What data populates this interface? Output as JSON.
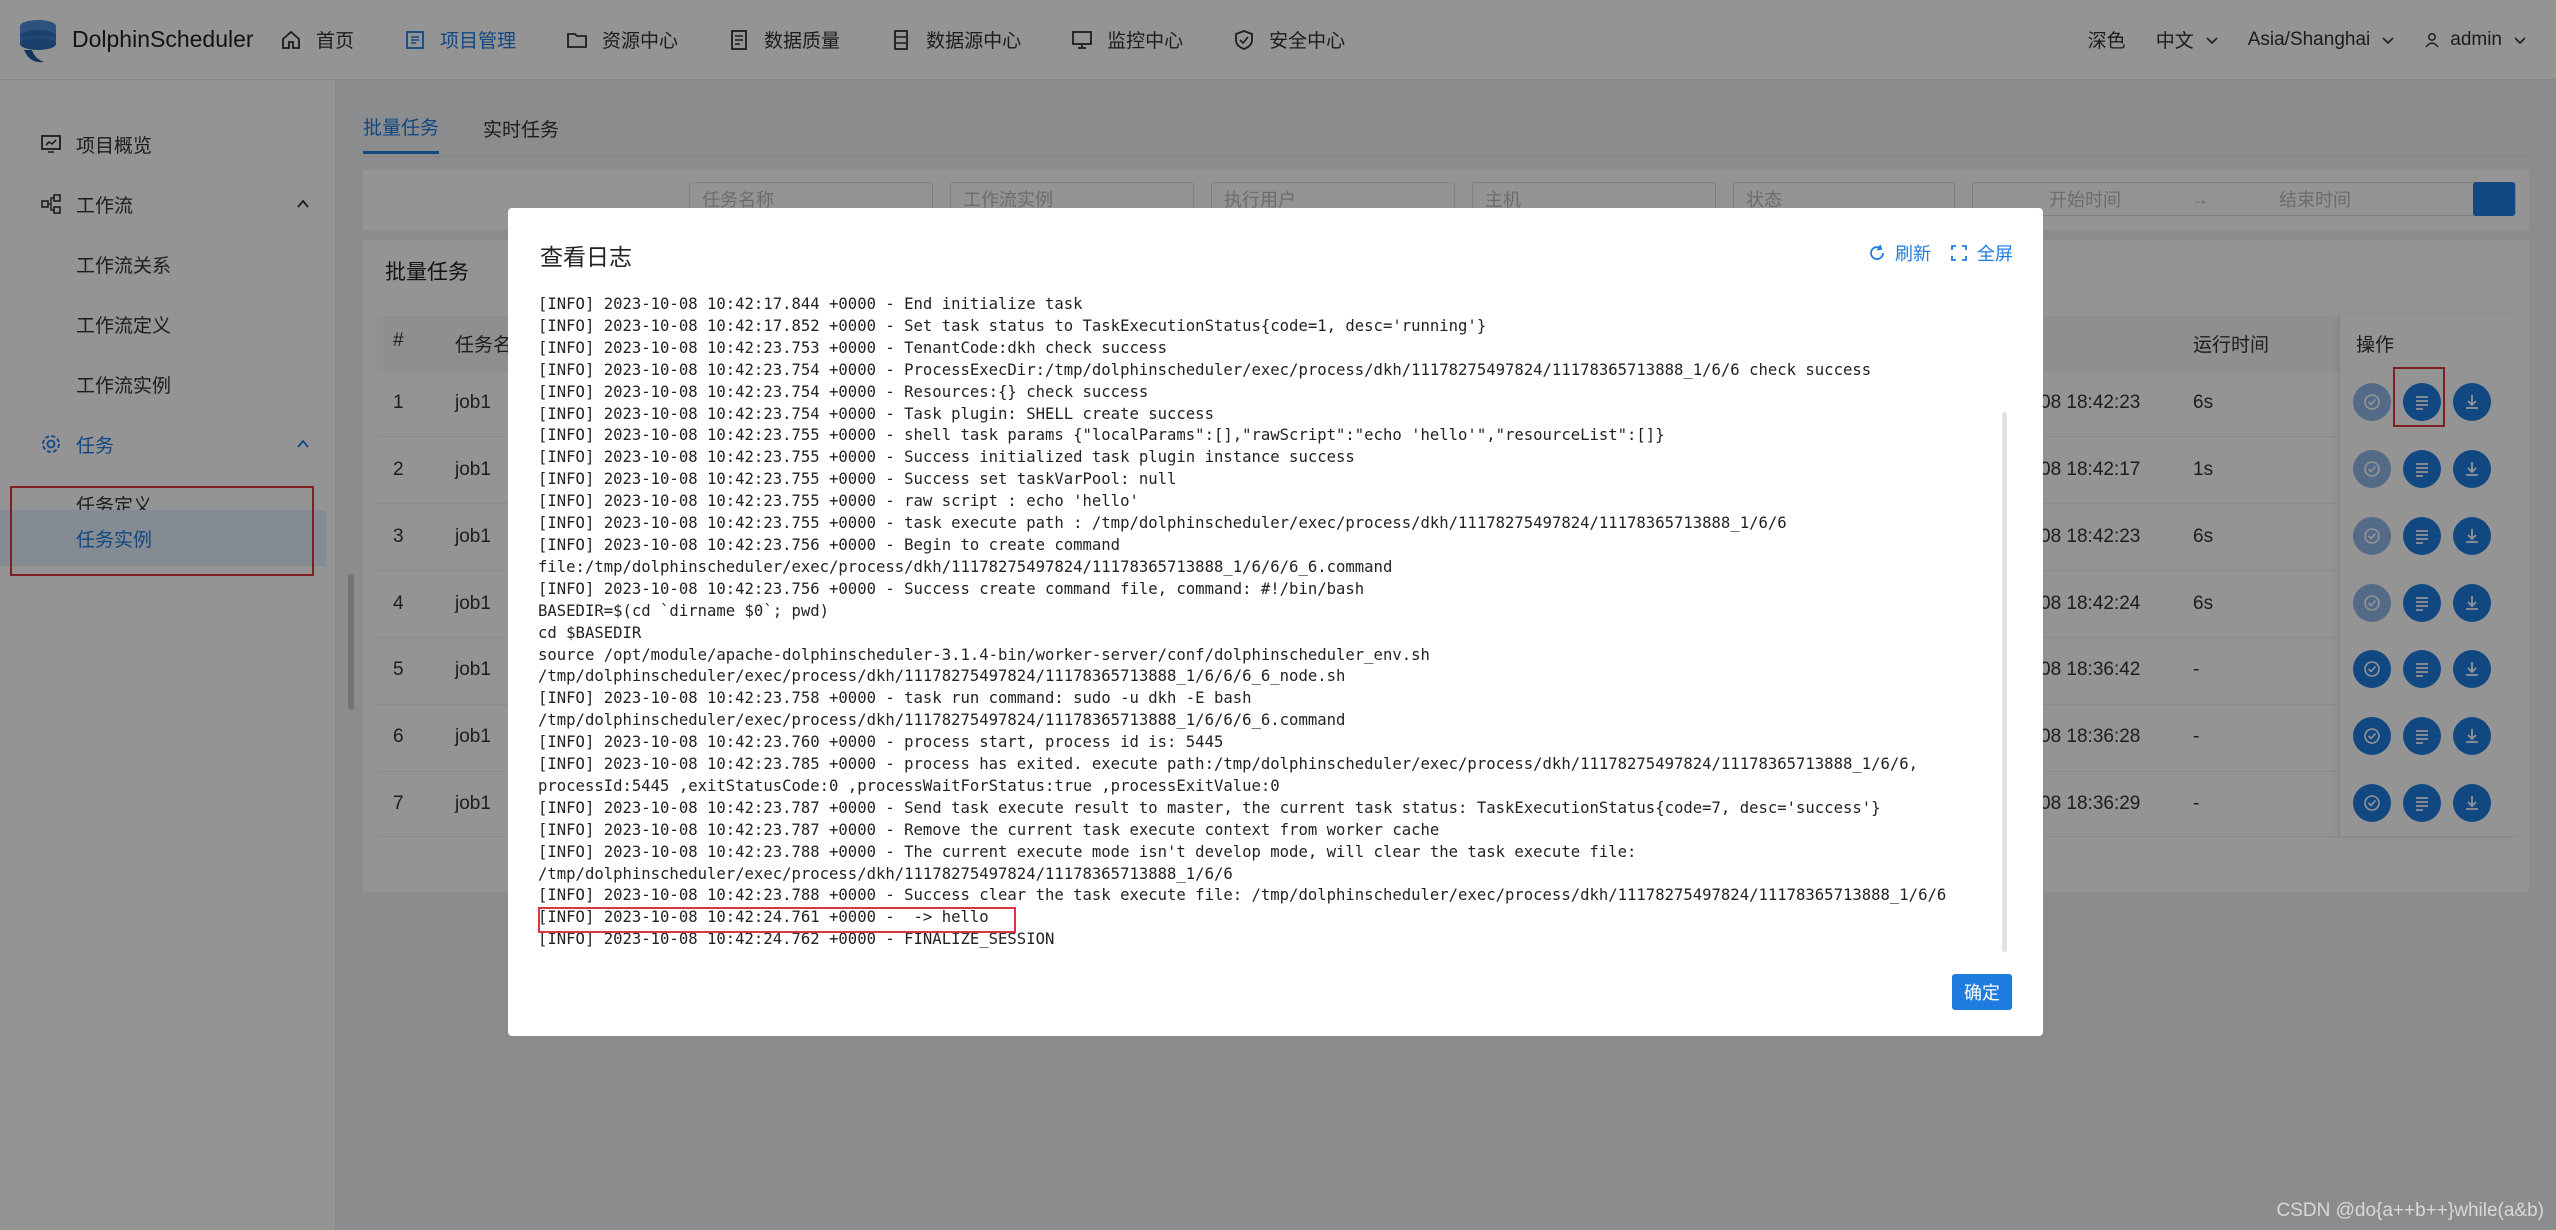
{
  "header": {
    "logo_text": "DolphinScheduler",
    "nav": [
      {
        "label": "首页",
        "icon": "home-icon"
      },
      {
        "label": "项目管理",
        "icon": "project-icon",
        "active": true
      },
      {
        "label": "资源中心",
        "icon": "folder-icon"
      },
      {
        "label": "数据质量",
        "icon": "data-quality-icon"
      },
      {
        "label": "数据源中心",
        "icon": "datasource-icon"
      },
      {
        "label": "监控中心",
        "icon": "monitor-icon"
      },
      {
        "label": "安全中心",
        "icon": "shield-icon"
      }
    ],
    "theme": "深色",
    "language": "中文",
    "timezone": "Asia/Shanghai",
    "user": "admin"
  },
  "sidebar": {
    "project_overview": "项目概览",
    "workflow": "工作流",
    "workflow_relation": "工作流关系",
    "workflow_definition": "工作流定义",
    "workflow_instance": "工作流实例",
    "task": "任务",
    "task_definition": "任务定义",
    "task_instance": "任务实例"
  },
  "tabs": {
    "batch": "批量任务",
    "realtime": "实时任务"
  },
  "filters": {
    "task_name": "任务名称",
    "workflow_instance": "工作流实例",
    "exec_user": "执行用户",
    "host": "主机",
    "state": "状态",
    "start_time": "开始时间",
    "arrow": "→",
    "end_time": "结束时间"
  },
  "list": {
    "title": "批量任务",
    "columns": {
      "index": "#",
      "task_name": "任务名",
      "run_time": "运行时间",
      "ops": "操作"
    },
    "rows": [
      {
        "index": "1",
        "name": "job1",
        "end": "08 18:42:23",
        "duration": "6s",
        "dim": true
      },
      {
        "index": "2",
        "name": "job1",
        "end": "08 18:42:17",
        "duration": "1s",
        "dim": true
      },
      {
        "index": "3",
        "name": "job1",
        "end": "08 18:42:23",
        "duration": "6s",
        "dim": true
      },
      {
        "index": "4",
        "name": "job1",
        "end": "08 18:42:24",
        "duration": "6s",
        "dim": true
      },
      {
        "index": "5",
        "name": "job1",
        "end": "08 18:36:42",
        "duration": "-",
        "dim": false
      },
      {
        "index": "6",
        "name": "job1",
        "end": "08 18:36:28",
        "duration": "-",
        "dim": false
      },
      {
        "index": "7",
        "name": "job1",
        "end": "08 18:36:29",
        "duration": "-",
        "dim": false
      }
    ]
  },
  "modal": {
    "title": "查看日志",
    "refresh": "刷新",
    "fullscreen": "全屏",
    "ok": "确定",
    "log_lines": [
      "[INFO] 2023-10-08 10:42:17.844 +0000 - End initialize task",
      "[INFO] 2023-10-08 10:42:17.852 +0000 - Set task status to TaskExecutionStatus{code=1, desc='running'}",
      "[INFO] 2023-10-08 10:42:23.753 +0000 - TenantCode:dkh check success",
      "[INFO] 2023-10-08 10:42:23.754 +0000 - ProcessExecDir:/tmp/dolphinscheduler/exec/process/dkh/11178275497824/11178365713888_1/6/6 check success",
      "[INFO] 2023-10-08 10:42:23.754 +0000 - Resources:{} check success",
      "[INFO] 2023-10-08 10:42:23.754 +0000 - Task plugin: SHELL create success",
      "[INFO] 2023-10-08 10:42:23.755 +0000 - shell task params {\"localParams\":[],\"rawScript\":\"echo 'hello'\",\"resourceList\":[]}",
      "[INFO] 2023-10-08 10:42:23.755 +0000 - Success initialized task plugin instance success",
      "[INFO] 2023-10-08 10:42:23.755 +0000 - Success set taskVarPool: null",
      "[INFO] 2023-10-08 10:42:23.755 +0000 - raw script : echo 'hello'",
      "[INFO] 2023-10-08 10:42:23.755 +0000 - task execute path : /tmp/dolphinscheduler/exec/process/dkh/11178275497824/11178365713888_1/6/6",
      "[INFO] 2023-10-08 10:42:23.756 +0000 - Begin to create command",
      "file:/tmp/dolphinscheduler/exec/process/dkh/11178275497824/11178365713888_1/6/6/6_6.command",
      "[INFO] 2023-10-08 10:42:23.756 +0000 - Success create command file, command: #!/bin/bash",
      "BASEDIR=$(cd `dirname $0`; pwd)",
      "cd $BASEDIR",
      "source /opt/module/apache-dolphinscheduler-3.1.4-bin/worker-server/conf/dolphinscheduler_env.sh",
      "/tmp/dolphinscheduler/exec/process/dkh/11178275497824/11178365713888_1/6/6/6_6_node.sh",
      "[INFO] 2023-10-08 10:42:23.758 +0000 - task run command: sudo -u dkh -E bash",
      "/tmp/dolphinscheduler/exec/process/dkh/11178275497824/11178365713888_1/6/6/6_6.command",
      "[INFO] 2023-10-08 10:42:23.760 +0000 - process start, process id is: 5445",
      "[INFO] 2023-10-08 10:42:23.785 +0000 - process has exited. execute path:/tmp/dolphinscheduler/exec/process/dkh/11178275497824/11178365713888_1/6/6,",
      "processId:5445 ,exitStatusCode:0 ,processWaitForStatus:true ,processExitValue:0",
      "[INFO] 2023-10-08 10:42:23.787 +0000 - Send task execute result to master, the current task status: TaskExecutionStatus{code=7, desc='success'}",
      "[INFO] 2023-10-08 10:42:23.787 +0000 - Remove the current task execute context from worker cache",
      "[INFO] 2023-10-08 10:42:23.788 +0000 - The current execute mode isn't develop mode, will clear the task execute file:",
      "/tmp/dolphinscheduler/exec/process/dkh/11178275497824/11178365713888_1/6/6",
      "[INFO] 2023-10-08 10:42:23.788 +0000 - Success clear the task execute file: /tmp/dolphinscheduler/exec/process/dkh/11178275497824/11178365713888_1/6/6",
      "[INFO] 2023-10-08 10:42:24.761 +0000 -  -> hello",
      "[INFO] 2023-10-08 10:42:24.762 +0000 - FINALIZE_SESSION"
    ]
  },
  "watermark": "CSDN @do{a++b++}while(a&b)",
  "colors": {
    "accent": "#1e7ce0",
    "highlight_box": "#d9363e"
  }
}
